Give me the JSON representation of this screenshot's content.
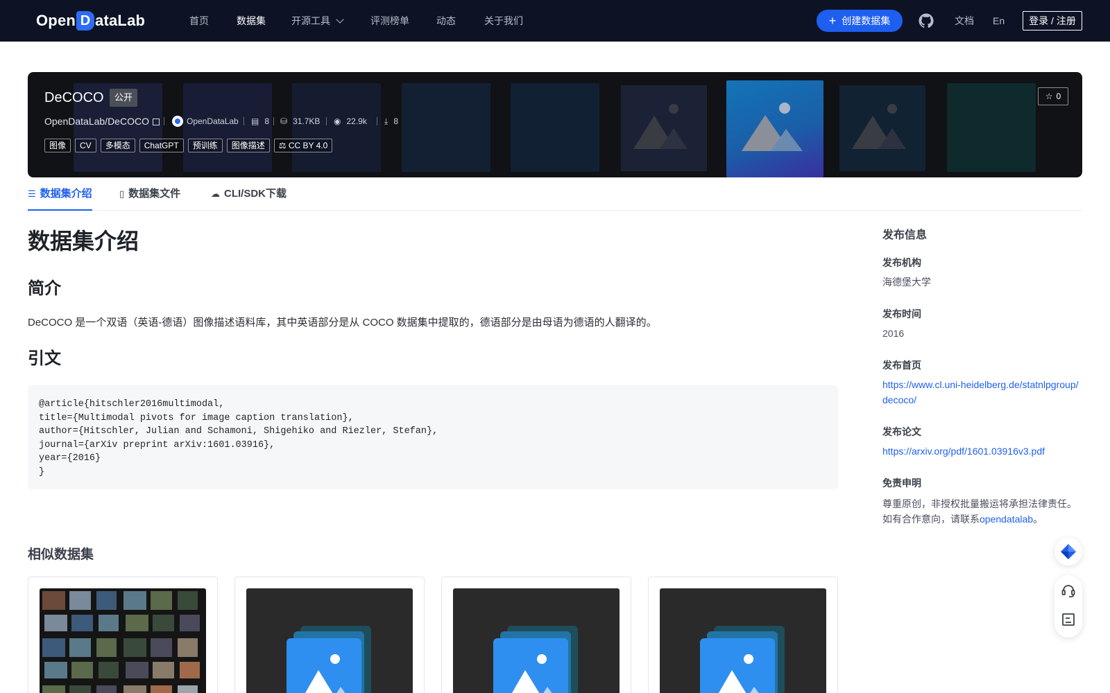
{
  "nav": {
    "logo_text_left": "Open",
    "logo_text_d": "D",
    "logo_text_right": "ataLab",
    "items": [
      {
        "label": "首页",
        "active": false
      },
      {
        "label": "数据集",
        "active": true
      },
      {
        "label": "开源工具",
        "active": false
      },
      {
        "label": "评测榜单",
        "active": false
      },
      {
        "label": "动态",
        "active": false
      },
      {
        "label": "关于我们",
        "active": false
      }
    ],
    "create_button": "创建数据集",
    "docs": "文档",
    "lang": "En",
    "login": "登录 / 注册",
    "icons": {
      "github": "github-icon",
      "dropdown": "chevron-down-icon",
      "plus": "plus-icon"
    }
  },
  "banner": {
    "title": "DeCOCO",
    "visibility": "公开",
    "path": "OpenDataLab/DeCOCO",
    "publisher": "OpenDataLab",
    "file_count": "8",
    "size": "31.7KB",
    "views": "22.9k",
    "downloads": "8",
    "tags": [
      "图像",
      "CV",
      "多模态",
      "ChatGPT",
      "预训练",
      "图像描述"
    ],
    "license": "CC BY 4.0",
    "stars": "0"
  },
  "tabs": [
    {
      "label": "数据集介绍",
      "active": true
    },
    {
      "label": "数据集文件",
      "active": false
    },
    {
      "label": "CLI/SDK下载",
      "active": false
    }
  ],
  "main": {
    "heading": "数据集介绍",
    "intro_heading": "简介",
    "intro_text": "DeCOCO 是一个双语（英语-德语）图像描述语料库，其中英语部分是从 COCO 数据集中提取的，德语部分是由母语为德语的人翻译的。",
    "citation_heading": "引文",
    "citation_code": "@article{hitschler2016multimodal,\ntitle={Multimodal pivots for image caption translation},\nauthor={Hitschler, Julian and Schamoni, Shigehiko and Riezler, Stefan},\njournal={arXiv preprint arXiv:1601.03916},\nyear={2016}\n}",
    "similar_heading": "相似数据集"
  },
  "sidebar": {
    "title": "发布信息",
    "org_label": "发布机构",
    "org_value": "海德堡大学",
    "time_label": "发布时间",
    "time_value": "2016",
    "home_label": "发布首页",
    "home_value": "https://www.cl.uni-heidelberg.de/statnlpgroup/decoco/",
    "paper_label": "发布论文",
    "paper_value": "https://arxiv.org/pdf/1601.03916v3.pdf",
    "disclaimer_label": "免责申明",
    "disclaimer_line1": "尊重原创，非授权批量搬运将承担法律责任。",
    "disclaimer_line2_prefix": "如有合作意向，请联系",
    "disclaimer_link": "opendatalab",
    "disclaimer_suffix": "。"
  },
  "colors": {
    "nav_bg": "#0d1325",
    "accent": "#1f5ff0",
    "banner_bg": "#111216"
  }
}
